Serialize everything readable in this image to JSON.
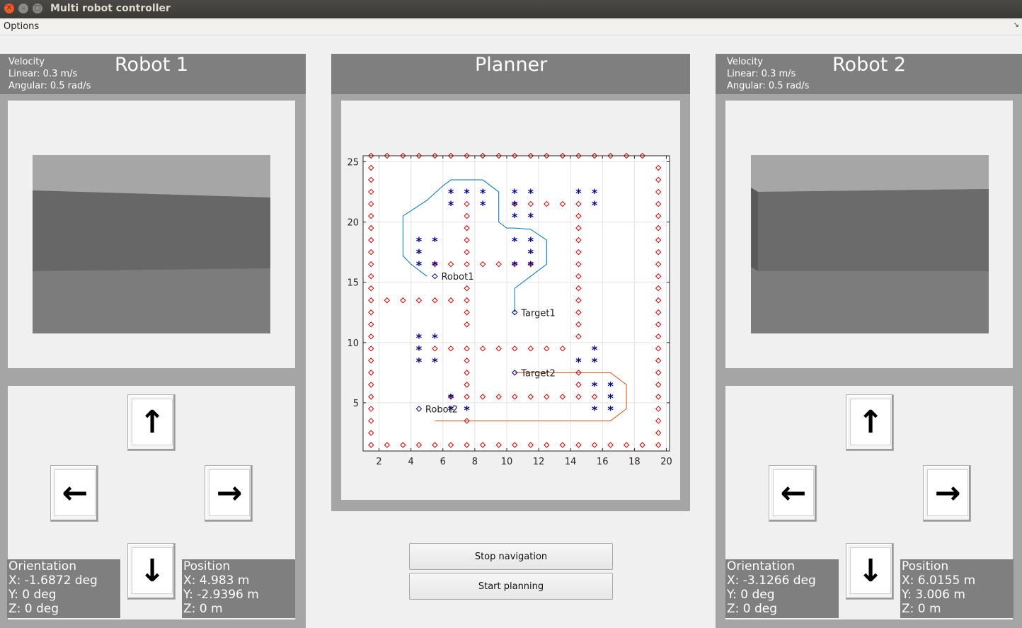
{
  "window": {
    "title": "Multi robot controller"
  },
  "menu": {
    "options_label": "Options"
  },
  "robot1": {
    "title": "Robot 1",
    "velocity": {
      "label": "Velocity",
      "linear": "Linear: 0.3 m/s",
      "angular": "Angular: 0.5 rad/s"
    },
    "orientation": {
      "label": "Orientation",
      "x": "X: -1.6872 deg",
      "y": "Y: 0 deg",
      "z": "Z: 0 deg"
    },
    "position": {
      "label": "Position",
      "x": "X: 4.983 m",
      "y": "Y: -2.9396 m",
      "z": "Z: 0 m"
    },
    "buttons": {
      "up": "↑",
      "left": "←",
      "right": "→",
      "down": "↓"
    }
  },
  "robot2": {
    "title": "Robot 2",
    "velocity": {
      "label": "Velocity",
      "linear": "Linear: 0.3 m/s",
      "angular": "Angular: 0.5 rad/s"
    },
    "orientation": {
      "label": "Orientation",
      "x": "X: -3.1266 deg",
      "y": "Y: 0 deg",
      "z": "Z: 0 deg"
    },
    "position": {
      "label": "Position",
      "x": "X: 6.0155 m",
      "y": "Y: 3.006 m",
      "z": "Z: 0 m"
    },
    "buttons": {
      "up": "↑",
      "left": "←",
      "right": "→",
      "down": "↓"
    }
  },
  "planner": {
    "title": "Planner",
    "stop_label": "Stop navigation",
    "start_label": "Start planning"
  },
  "chart_data": {
    "type": "scatter",
    "xlim": [
      1,
      20.2
    ],
    "ylim": [
      1,
      25.5
    ],
    "xticks": [
      2,
      4,
      6,
      8,
      10,
      12,
      14,
      16,
      18,
      20
    ],
    "yticks": [
      5,
      10,
      15,
      20,
      25
    ],
    "grid": true,
    "obstacles_color": "#d00000",
    "stars_color": "#000090",
    "path1_color": "#0072bd",
    "path2_color": "#d95319",
    "obstacles": [
      [
        1.5,
        1.5
      ],
      [
        2.5,
        1.5
      ],
      [
        3.5,
        1.5
      ],
      [
        4.5,
        1.5
      ],
      [
        5.5,
        1.5
      ],
      [
        6.5,
        1.5
      ],
      [
        7.5,
        1.5
      ],
      [
        8.5,
        1.5
      ],
      [
        9.5,
        1.5
      ],
      [
        10.5,
        1.5
      ],
      [
        11.5,
        1.5
      ],
      [
        12.5,
        1.5
      ],
      [
        13.5,
        1.5
      ],
      [
        14.5,
        1.5
      ],
      [
        15.5,
        1.5
      ],
      [
        16.5,
        1.5
      ],
      [
        17.5,
        1.5
      ],
      [
        18.5,
        1.5
      ],
      [
        19.5,
        1.5
      ],
      [
        1.5,
        25.5
      ],
      [
        2.5,
        25.5
      ],
      [
        3.5,
        25.5
      ],
      [
        4.5,
        25.5
      ],
      [
        5.5,
        25.5
      ],
      [
        6.5,
        25.5
      ],
      [
        7.5,
        25.5
      ],
      [
        8.5,
        25.5
      ],
      [
        9.5,
        25.5
      ],
      [
        10.5,
        25.5
      ],
      [
        11.5,
        25.5
      ],
      [
        12.5,
        25.5
      ],
      [
        13.5,
        25.5
      ],
      [
        14.5,
        25.5
      ],
      [
        15.5,
        25.5
      ],
      [
        16.5,
        25.5
      ],
      [
        17.5,
        25.5
      ],
      [
        18.5,
        25.5
      ],
      [
        1.5,
        2.5
      ],
      [
        1.5,
        3.5
      ],
      [
        1.5,
        4.5
      ],
      [
        1.5,
        5.5
      ],
      [
        1.5,
        6.5
      ],
      [
        1.5,
        7.5
      ],
      [
        1.5,
        8.5
      ],
      [
        1.5,
        9.5
      ],
      [
        1.5,
        10.5
      ],
      [
        1.5,
        11.5
      ],
      [
        1.5,
        12.5
      ],
      [
        1.5,
        13.5
      ],
      [
        1.5,
        14.5
      ],
      [
        1.5,
        15.5
      ],
      [
        1.5,
        16.5
      ],
      [
        1.5,
        17.5
      ],
      [
        1.5,
        18.5
      ],
      [
        1.5,
        19.5
      ],
      [
        1.5,
        20.5
      ],
      [
        1.5,
        21.5
      ],
      [
        1.5,
        22.5
      ],
      [
        1.5,
        23.5
      ],
      [
        1.5,
        24.5
      ],
      [
        19.5,
        2.5
      ],
      [
        19.5,
        3.5
      ],
      [
        19.5,
        4.5
      ],
      [
        19.5,
        5.5
      ],
      [
        19.5,
        6.5
      ],
      [
        19.5,
        7.5
      ],
      [
        19.5,
        8.5
      ],
      [
        19.5,
        9.5
      ],
      [
        19.5,
        10.5
      ],
      [
        19.5,
        11.5
      ],
      [
        19.5,
        12.5
      ],
      [
        19.5,
        13.5
      ],
      [
        19.5,
        14.5
      ],
      [
        19.5,
        15.5
      ],
      [
        19.5,
        16.5
      ],
      [
        19.5,
        17.5
      ],
      [
        19.5,
        18.5
      ],
      [
        19.5,
        19.5
      ],
      [
        19.5,
        20.5
      ],
      [
        19.5,
        21.5
      ],
      [
        19.5,
        22.5
      ],
      [
        19.5,
        23.5
      ],
      [
        19.5,
        24.5
      ],
      [
        2.5,
        13.5
      ],
      [
        3.5,
        13.5
      ],
      [
        4.5,
        13.5
      ],
      [
        5.5,
        13.5
      ],
      [
        6.5,
        13.5
      ],
      [
        7.5,
        13.5
      ],
      [
        7.5,
        3.5
      ],
      [
        7.5,
        5.5
      ],
      [
        7.5,
        6.5
      ],
      [
        7.5,
        7.5
      ],
      [
        7.5,
        8.5
      ],
      [
        7.5,
        9.5
      ],
      [
        7.5,
        11.5
      ],
      [
        7.5,
        12.5
      ],
      [
        7.5,
        14.5
      ],
      [
        7.5,
        16.5
      ],
      [
        7.5,
        17.5
      ],
      [
        7.5,
        18.5
      ],
      [
        7.5,
        19.5
      ],
      [
        7.5,
        20.5
      ],
      [
        7.5,
        21.5
      ],
      [
        5.5,
        9.5
      ],
      [
        6.5,
        9.5
      ],
      [
        8.5,
        9.5
      ],
      [
        9.5,
        9.5
      ],
      [
        10.5,
        9.5
      ],
      [
        11.5,
        9.5
      ],
      [
        12.5,
        9.5
      ],
      [
        13.5,
        9.5
      ],
      [
        6.5,
        5.5
      ],
      [
        8.5,
        5.5
      ],
      [
        9.5,
        5.5
      ],
      [
        10.5,
        5.5
      ],
      [
        11.5,
        5.5
      ],
      [
        12.5,
        5.5
      ],
      [
        13.5,
        5.5
      ],
      [
        14.5,
        5.5
      ],
      [
        15.5,
        5.5
      ],
      [
        14.5,
        6.5
      ],
      [
        14.5,
        7.5
      ],
      [
        14.5,
        10.5
      ],
      [
        14.5,
        11.5
      ],
      [
        14.5,
        12.5
      ],
      [
        14.5,
        13.5
      ],
      [
        14.5,
        14.5
      ],
      [
        14.5,
        15.5
      ],
      [
        14.5,
        16.5
      ],
      [
        14.5,
        17.5
      ],
      [
        14.5,
        18.5
      ],
      [
        14.5,
        19.5
      ],
      [
        14.5,
        20.5
      ],
      [
        14.5,
        21.5
      ],
      [
        5.5,
        16.5
      ],
      [
        6.5,
        16.5
      ],
      [
        8.5,
        16.5
      ],
      [
        9.5,
        16.5
      ],
      [
        10.5,
        16.5
      ],
      [
        11.5,
        16.5
      ],
      [
        10.5,
        21.5
      ],
      [
        11.5,
        21.5
      ],
      [
        12.5,
        21.5
      ],
      [
        13.5,
        21.5
      ]
    ],
    "stars": [
      [
        6.5,
        22.5
      ],
      [
        7.5,
        22.5
      ],
      [
        8.5,
        22.5
      ],
      [
        6.5,
        21.5
      ],
      [
        8.5,
        21.5
      ],
      [
        10.5,
        22.5
      ],
      [
        11.5,
        22.5
      ],
      [
        10.5,
        21.5
      ],
      [
        10.5,
        20.5
      ],
      [
        11.5,
        20.5
      ],
      [
        14.5,
        22.5
      ],
      [
        15.5,
        22.5
      ],
      [
        15.5,
        21.5
      ],
      [
        4.5,
        18.5
      ],
      [
        5.5,
        18.5
      ],
      [
        4.5,
        17.5
      ],
      [
        4.5,
        16.5
      ],
      [
        5.5,
        16.5
      ],
      [
        10.5,
        18.5
      ],
      [
        11.5,
        18.5
      ],
      [
        11.5,
        17.5
      ],
      [
        10.5,
        16.5
      ],
      [
        11.5,
        16.5
      ],
      [
        4.5,
        10.5
      ],
      [
        5.5,
        10.5
      ],
      [
        4.5,
        9.5
      ],
      [
        4.5,
        8.5
      ],
      [
        5.5,
        8.5
      ],
      [
        15.5,
        9.5
      ],
      [
        14.5,
        8.5
      ],
      [
        15.5,
        8.5
      ],
      [
        6.5,
        5.5
      ],
      [
        6.5,
        4.5
      ],
      [
        7.5,
        4.5
      ],
      [
        15.5,
        6.5
      ],
      [
        16.5,
        6.5
      ],
      [
        16.5,
        5.5
      ],
      [
        15.5,
        4.5
      ],
      [
        16.5,
        4.5
      ]
    ],
    "markers": [
      {
        "label": "Robot1",
        "x": 5.5,
        "y": 15.5
      },
      {
        "label": "Target1",
        "x": 10.5,
        "y": 12.5
      },
      {
        "label": "Target2",
        "x": 10.5,
        "y": 7.5
      },
      {
        "label": "Robot2",
        "x": 4.5,
        "y": 4.5
      }
    ],
    "path1": [
      [
        5,
        15.5
      ],
      [
        4,
        16.5
      ],
      [
        3.5,
        17.2
      ],
      [
        3.5,
        20.5
      ],
      [
        5,
        21.8
      ],
      [
        6,
        23
      ],
      [
        6.5,
        23.5
      ],
      [
        8.5,
        23.5
      ],
      [
        9,
        23
      ],
      [
        9.5,
        22.5
      ],
      [
        9.5,
        20
      ],
      [
        10,
        19.5
      ],
      [
        10.5,
        19.5
      ],
      [
        11.5,
        19.4
      ],
      [
        12.5,
        18.5
      ],
      [
        12.5,
        16.5
      ],
      [
        11.5,
        15.5
      ],
      [
        10.5,
        14.5
      ],
      [
        10.5,
        12.5
      ]
    ],
    "path2": [
      [
        10.5,
        7.5
      ],
      [
        16.5,
        7.5
      ],
      [
        17.5,
        6.5
      ],
      [
        17.5,
        4.5
      ],
      [
        16.5,
        3.5
      ],
      [
        5.5,
        3.5
      ]
    ]
  }
}
